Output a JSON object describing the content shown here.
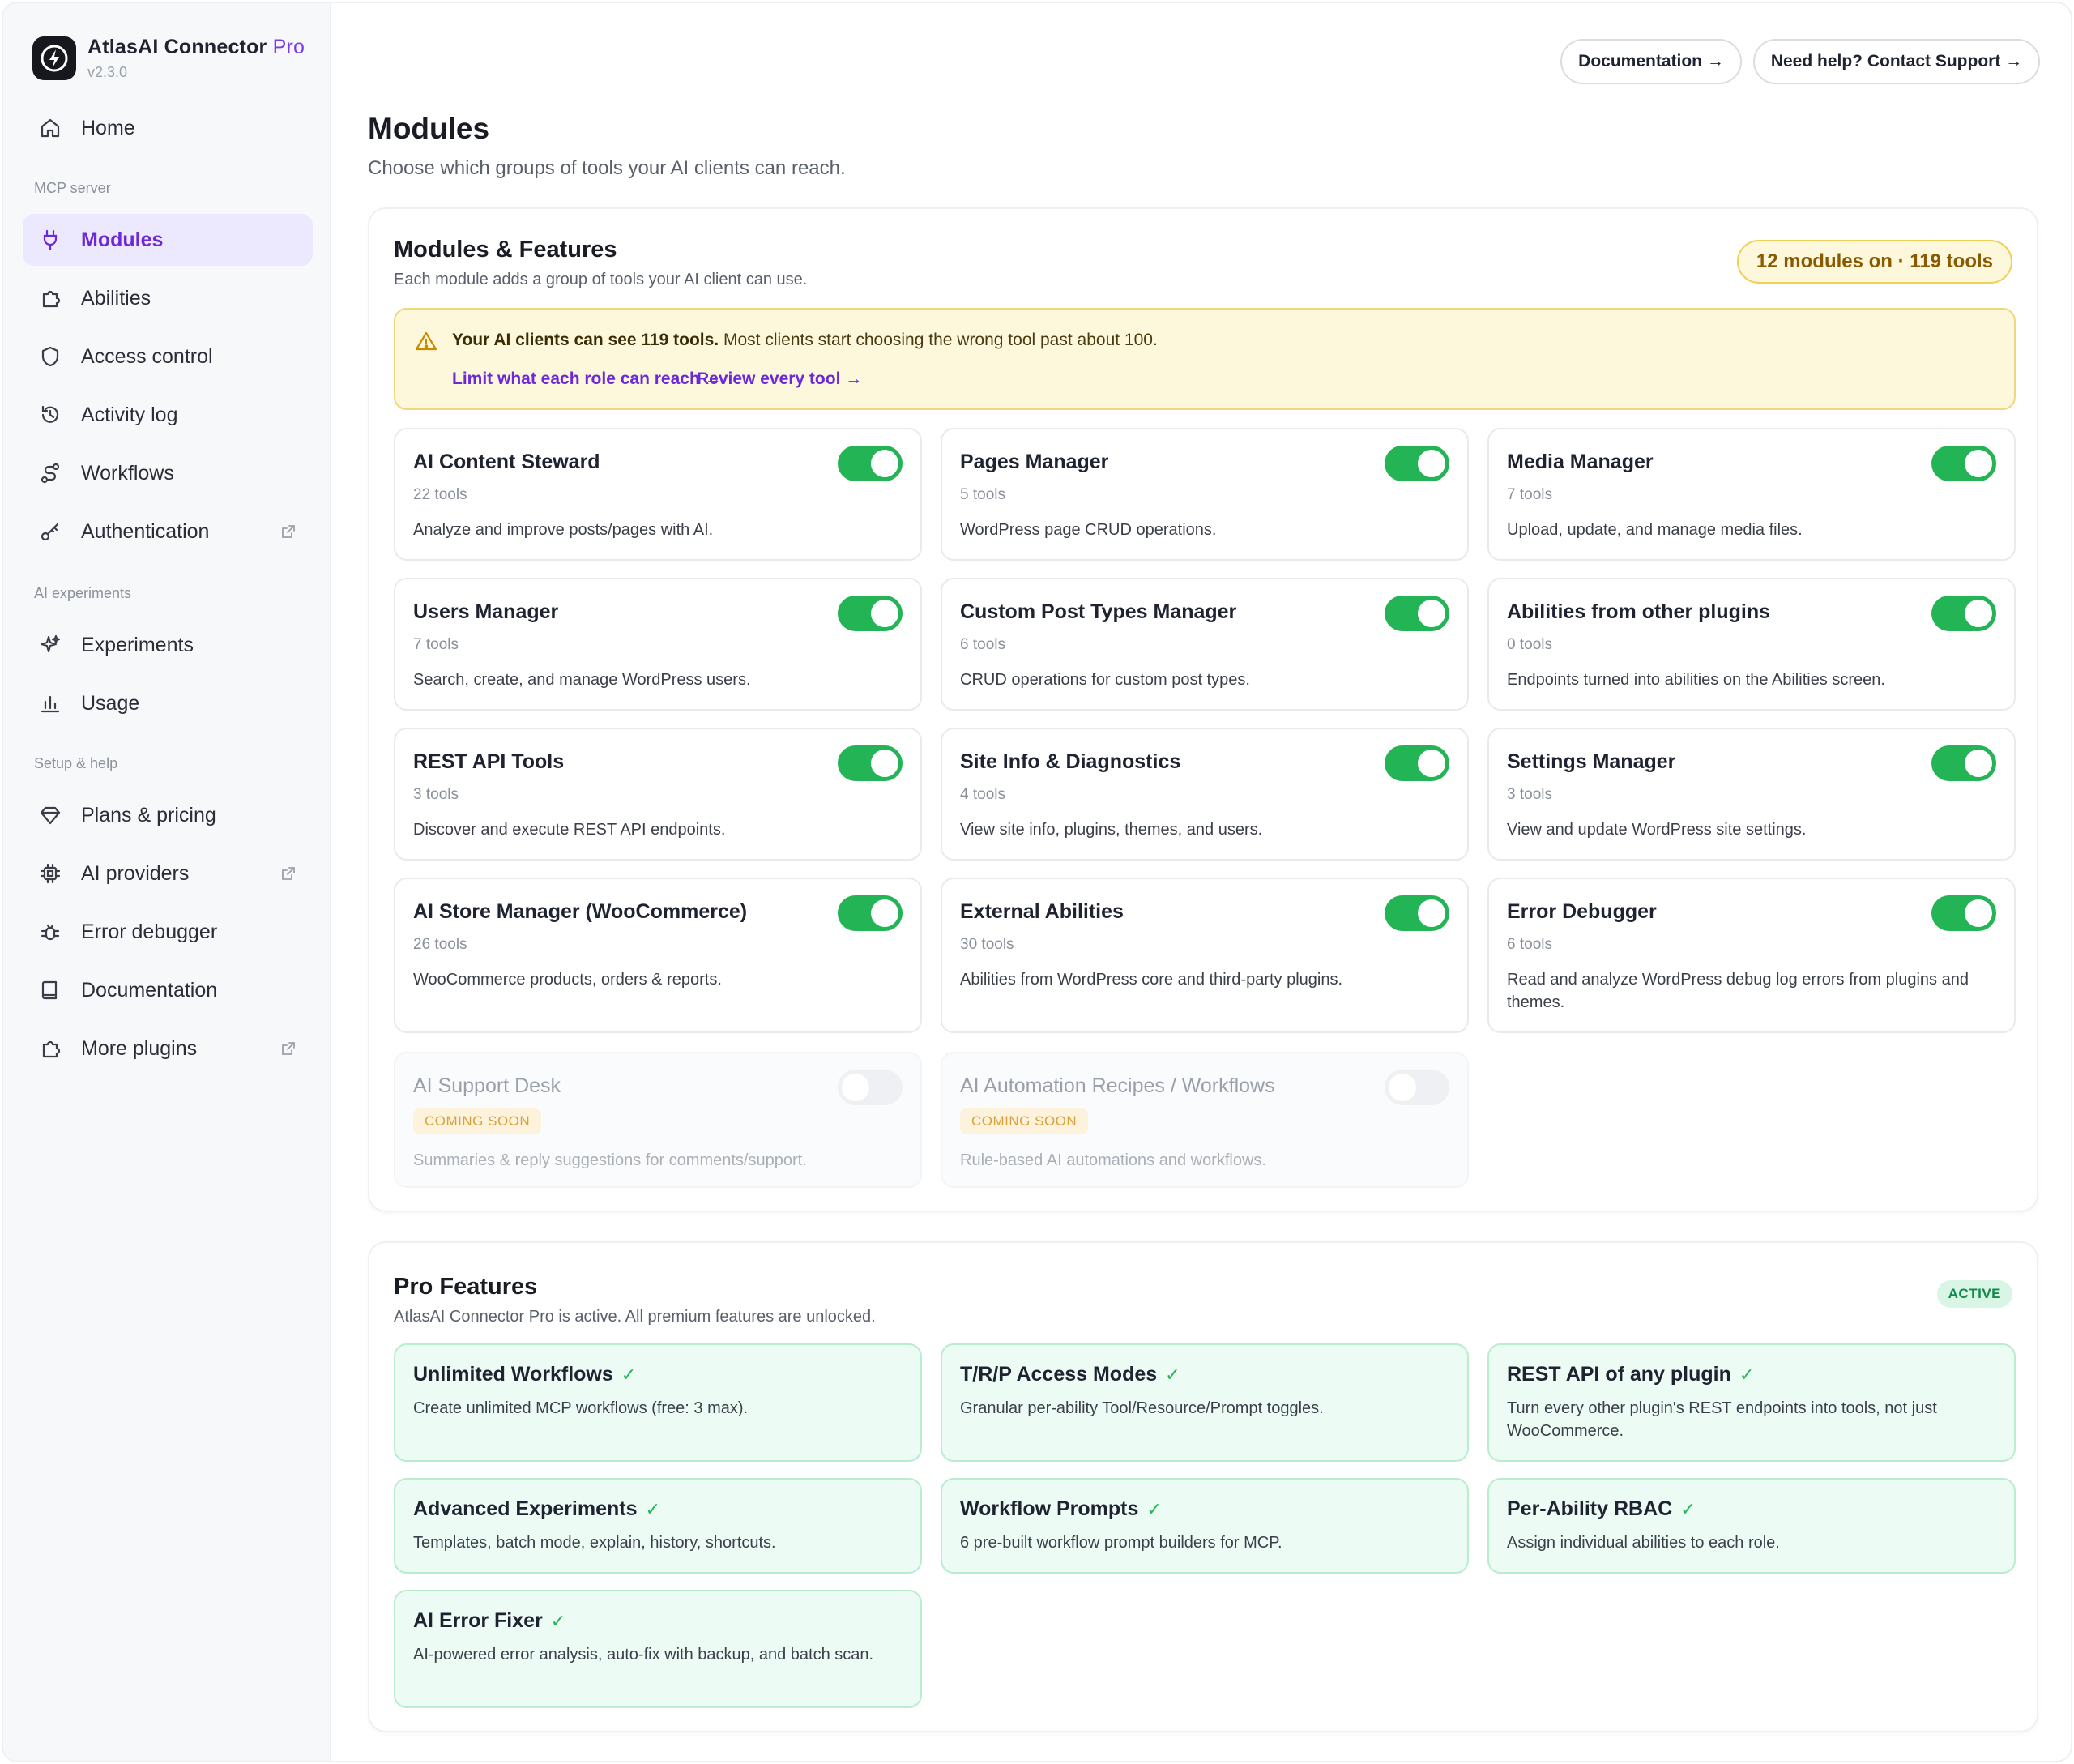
{
  "brand": {
    "name": "AtlasAI Connector",
    "pro": "Pro",
    "version": "v2.3.0"
  },
  "sidebar": {
    "home": {
      "label": "Home",
      "icon": "home-icon"
    },
    "sections": [
      "MCP server",
      "AI experiments",
      "Setup & help"
    ],
    "items": [
      {
        "label": "Modules",
        "icon": "plug-icon",
        "active": true
      },
      {
        "label": "Abilities",
        "icon": "puzzle-icon"
      },
      {
        "label": "Access control",
        "icon": "shield-icon"
      },
      {
        "label": "Activity log",
        "icon": "history-icon"
      },
      {
        "label": "Workflows",
        "icon": "route-icon"
      },
      {
        "label": "Authentication",
        "icon": "key-icon",
        "external": true
      },
      {
        "label": "Experiments",
        "icon": "sparkles-icon"
      },
      {
        "label": "Usage",
        "icon": "bar-chart-icon"
      },
      {
        "label": "Plans & pricing",
        "icon": "gem-icon"
      },
      {
        "label": "AI providers",
        "icon": "cpu-icon",
        "external": true
      },
      {
        "label": "Error debugger",
        "icon": "bug-icon"
      },
      {
        "label": "Documentation",
        "icon": "book-icon"
      },
      {
        "label": "More plugins",
        "icon": "puzzle-icon",
        "external": true
      }
    ]
  },
  "header": {
    "documentation_button": "Documentation →",
    "support_button": "Need help? Contact Support →",
    "title": "Modules",
    "subtitle": "Choose which groups of tools your AI clients can reach."
  },
  "modules_panel": {
    "title": "Modules & Features",
    "subtitle": "Each module adds a group of tools your AI client can use.",
    "count_badge": "12 modules on · 119 tools",
    "warning": {
      "bold": "Your AI clients can see 119 tools.",
      "text": " Most clients start choosing the wrong tool past about 100.",
      "link1": "Limit what each role can reach →",
      "link2": "Review every tool →"
    },
    "modules": [
      {
        "title": "AI Content Steward",
        "count": "22 tools",
        "desc": "Analyze and improve posts/pages with AI.",
        "enabled": true
      },
      {
        "title": "Pages Manager",
        "count": "5 tools",
        "desc": "WordPress page CRUD operations.",
        "enabled": true
      },
      {
        "title": "Media Manager",
        "count": "7 tools",
        "desc": "Upload, update, and manage media files.",
        "enabled": true
      },
      {
        "title": "Users Manager",
        "count": "7 tools",
        "desc": "Search, create, and manage WordPress users.",
        "enabled": true
      },
      {
        "title": "Custom Post Types Manager",
        "count": "6 tools",
        "desc": "CRUD operations for custom post types.",
        "enabled": true
      },
      {
        "title": "Abilities from other plugins",
        "count": "0 tools",
        "desc": "Endpoints turned into abilities on the Abilities screen.",
        "enabled": true
      },
      {
        "title": "REST API Tools",
        "count": "3 tools",
        "desc": "Discover and execute REST API endpoints.",
        "enabled": true
      },
      {
        "title": "Site Info & Diagnostics",
        "count": "4 tools",
        "desc": "View site info, plugins, themes, and users.",
        "enabled": true
      },
      {
        "title": "Settings Manager",
        "count": "3 tools",
        "desc": "View and update WordPress site settings.",
        "enabled": true
      },
      {
        "title": "AI Store Manager (WooCommerce)",
        "count": "26 tools",
        "desc": "WooCommerce products, orders & reports.",
        "enabled": true
      },
      {
        "title": "External Abilities",
        "count": "30 tools",
        "desc": "Abilities from WordPress core and third-party plugins.",
        "enabled": true
      },
      {
        "title": "Error Debugger",
        "count": "6 tools",
        "desc": "Read and analyze WordPress debug log errors from plugins and themes.",
        "enabled": true
      }
    ],
    "coming_soon": [
      {
        "title": "AI Support Desk",
        "badge": "COMING SOON",
        "desc": "Summaries & reply suggestions for comments/support."
      },
      {
        "title": "AI Automation Recipes / Workflows",
        "badge": "COMING SOON",
        "desc": "Rule-based AI automations and workflows."
      }
    ]
  },
  "pro_panel": {
    "title": "Pro Features",
    "subtitle": "AtlasAI Connector Pro is active. All premium features are unlocked.",
    "badge": "ACTIVE",
    "check": "✓",
    "features": [
      {
        "title": "Unlimited Workflows",
        "desc": "Create unlimited MCP workflows (free: 3 max)."
      },
      {
        "title": "T/R/P Access Modes",
        "desc": "Granular per-ability Tool/Resource/Prompt toggles."
      },
      {
        "title": "REST API of any plugin",
        "desc": "Turn every other plugin's REST endpoints into tools, not just WooCommerce."
      },
      {
        "title": "Advanced Experiments",
        "desc": "Templates, batch mode, explain, history, shortcuts."
      },
      {
        "title": "Workflow Prompts",
        "desc": "6 pre-built workflow prompt builders for MCP."
      },
      {
        "title": "Per-Ability RBAC",
        "desc": "Assign individual abilities to each role."
      },
      {
        "title": "AI Error Fixer",
        "desc": "AI-powered error analysis, auto-fix with backup, and batch scan."
      }
    ]
  },
  "colors": {
    "accent": "#6d28d9",
    "toggle_on": "#22b455",
    "warning_bg": "#fdf7dc",
    "pro_bg": "#ecfbf3"
  }
}
